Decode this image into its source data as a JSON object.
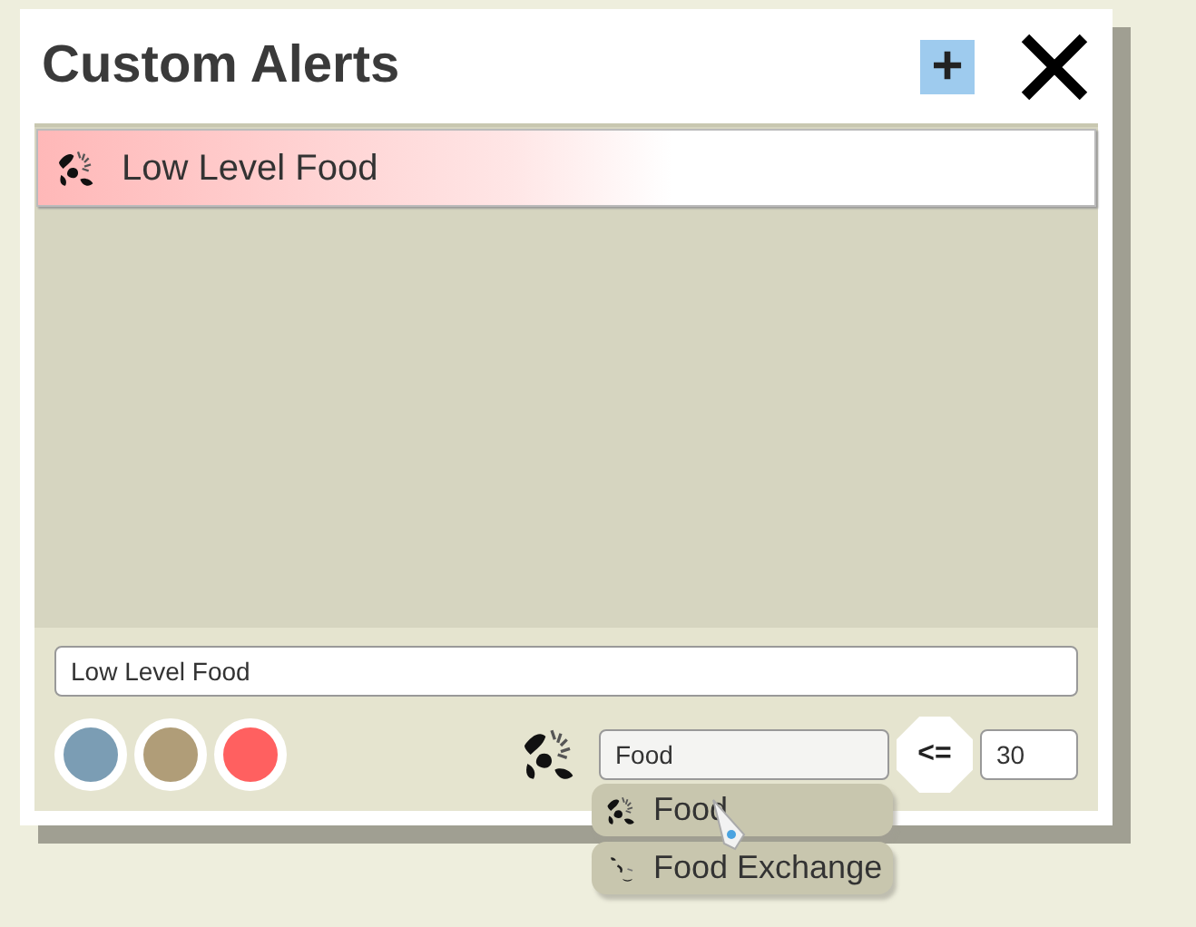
{
  "window": {
    "title": "Custom Alerts",
    "add_label": "+"
  },
  "alerts": [
    {
      "name": "Low Level Food",
      "selected": true
    }
  ],
  "editor": {
    "name_value": "Low Level Food",
    "colors": [
      {
        "color": "#7b9db4"
      },
      {
        "color": "#b09d78"
      },
      {
        "color": "#ff6060"
      }
    ],
    "resource_value": "Food",
    "operator": "<=",
    "threshold_value": "30"
  },
  "dropdown": {
    "items": [
      {
        "label": "Food",
        "kind": "food"
      },
      {
        "label": "Food Exchange",
        "kind": "exchange"
      }
    ]
  }
}
